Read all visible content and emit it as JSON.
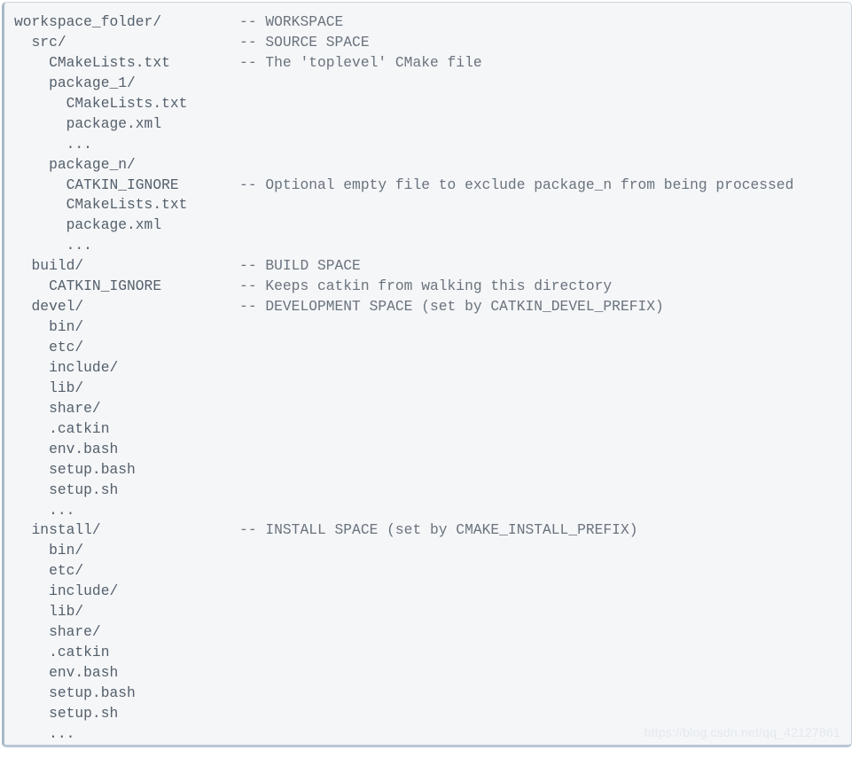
{
  "block": {
    "language": "text",
    "background_color": "#f5f6f8",
    "border_color": "#c9d3de",
    "accent_border_color": "#aab8c7",
    "text_color": "#4f5b66",
    "comment_color": "#6a737d",
    "comment_column": 26,
    "indent_size": 2
  },
  "watermark": {
    "text": "https://blog.csdn.net/qq_42127861",
    "color": "#e2e8ef"
  },
  "lines": [
    {
      "indent": 0,
      "path": "workspace_folder/",
      "comment": "-- WORKSPACE"
    },
    {
      "indent": 1,
      "path": "src/",
      "comment": "-- SOURCE SPACE"
    },
    {
      "indent": 2,
      "path": "CMakeLists.txt",
      "comment": "-- The 'toplevel' CMake file"
    },
    {
      "indent": 2,
      "path": "package_1/",
      "comment": ""
    },
    {
      "indent": 3,
      "path": "CMakeLists.txt",
      "comment": ""
    },
    {
      "indent": 3,
      "path": "package.xml",
      "comment": ""
    },
    {
      "indent": 3,
      "path": "...",
      "comment": ""
    },
    {
      "indent": 2,
      "path": "package_n/",
      "comment": ""
    },
    {
      "indent": 3,
      "path": "CATKIN_IGNORE",
      "comment": "-- Optional empty file to exclude package_n from being processed"
    },
    {
      "indent": 3,
      "path": "CMakeLists.txt",
      "comment": ""
    },
    {
      "indent": 3,
      "path": "package.xml",
      "comment": ""
    },
    {
      "indent": 3,
      "path": "...",
      "comment": ""
    },
    {
      "indent": 1,
      "path": "build/",
      "comment": "-- BUILD SPACE"
    },
    {
      "indent": 2,
      "path": "CATKIN_IGNORE",
      "comment": "-- Keeps catkin from walking this directory"
    },
    {
      "indent": 1,
      "path": "devel/",
      "comment": "-- DEVELOPMENT SPACE (set by CATKIN_DEVEL_PREFIX)"
    },
    {
      "indent": 2,
      "path": "bin/",
      "comment": ""
    },
    {
      "indent": 2,
      "path": "etc/",
      "comment": ""
    },
    {
      "indent": 2,
      "path": "include/",
      "comment": ""
    },
    {
      "indent": 2,
      "path": "lib/",
      "comment": ""
    },
    {
      "indent": 2,
      "path": "share/",
      "comment": ""
    },
    {
      "indent": 2,
      "path": ".catkin",
      "comment": ""
    },
    {
      "indent": 2,
      "path": "env.bash",
      "comment": ""
    },
    {
      "indent": 2,
      "path": "setup.bash",
      "comment": ""
    },
    {
      "indent": 2,
      "path": "setup.sh",
      "comment": ""
    },
    {
      "indent": 2,
      "path": "...",
      "comment": ""
    },
    {
      "indent": 1,
      "path": "install/",
      "comment": "-- INSTALL SPACE (set by CMAKE_INSTALL_PREFIX)"
    },
    {
      "indent": 2,
      "path": "bin/",
      "comment": ""
    },
    {
      "indent": 2,
      "path": "etc/",
      "comment": ""
    },
    {
      "indent": 2,
      "path": "include/",
      "comment": ""
    },
    {
      "indent": 2,
      "path": "lib/",
      "comment": ""
    },
    {
      "indent": 2,
      "path": "share/",
      "comment": ""
    },
    {
      "indent": 2,
      "path": ".catkin",
      "comment": ""
    },
    {
      "indent": 2,
      "path": "env.bash",
      "comment": ""
    },
    {
      "indent": 2,
      "path": "setup.bash",
      "comment": ""
    },
    {
      "indent": 2,
      "path": "setup.sh",
      "comment": ""
    },
    {
      "indent": 2,
      "path": "...",
      "comment": ""
    }
  ]
}
